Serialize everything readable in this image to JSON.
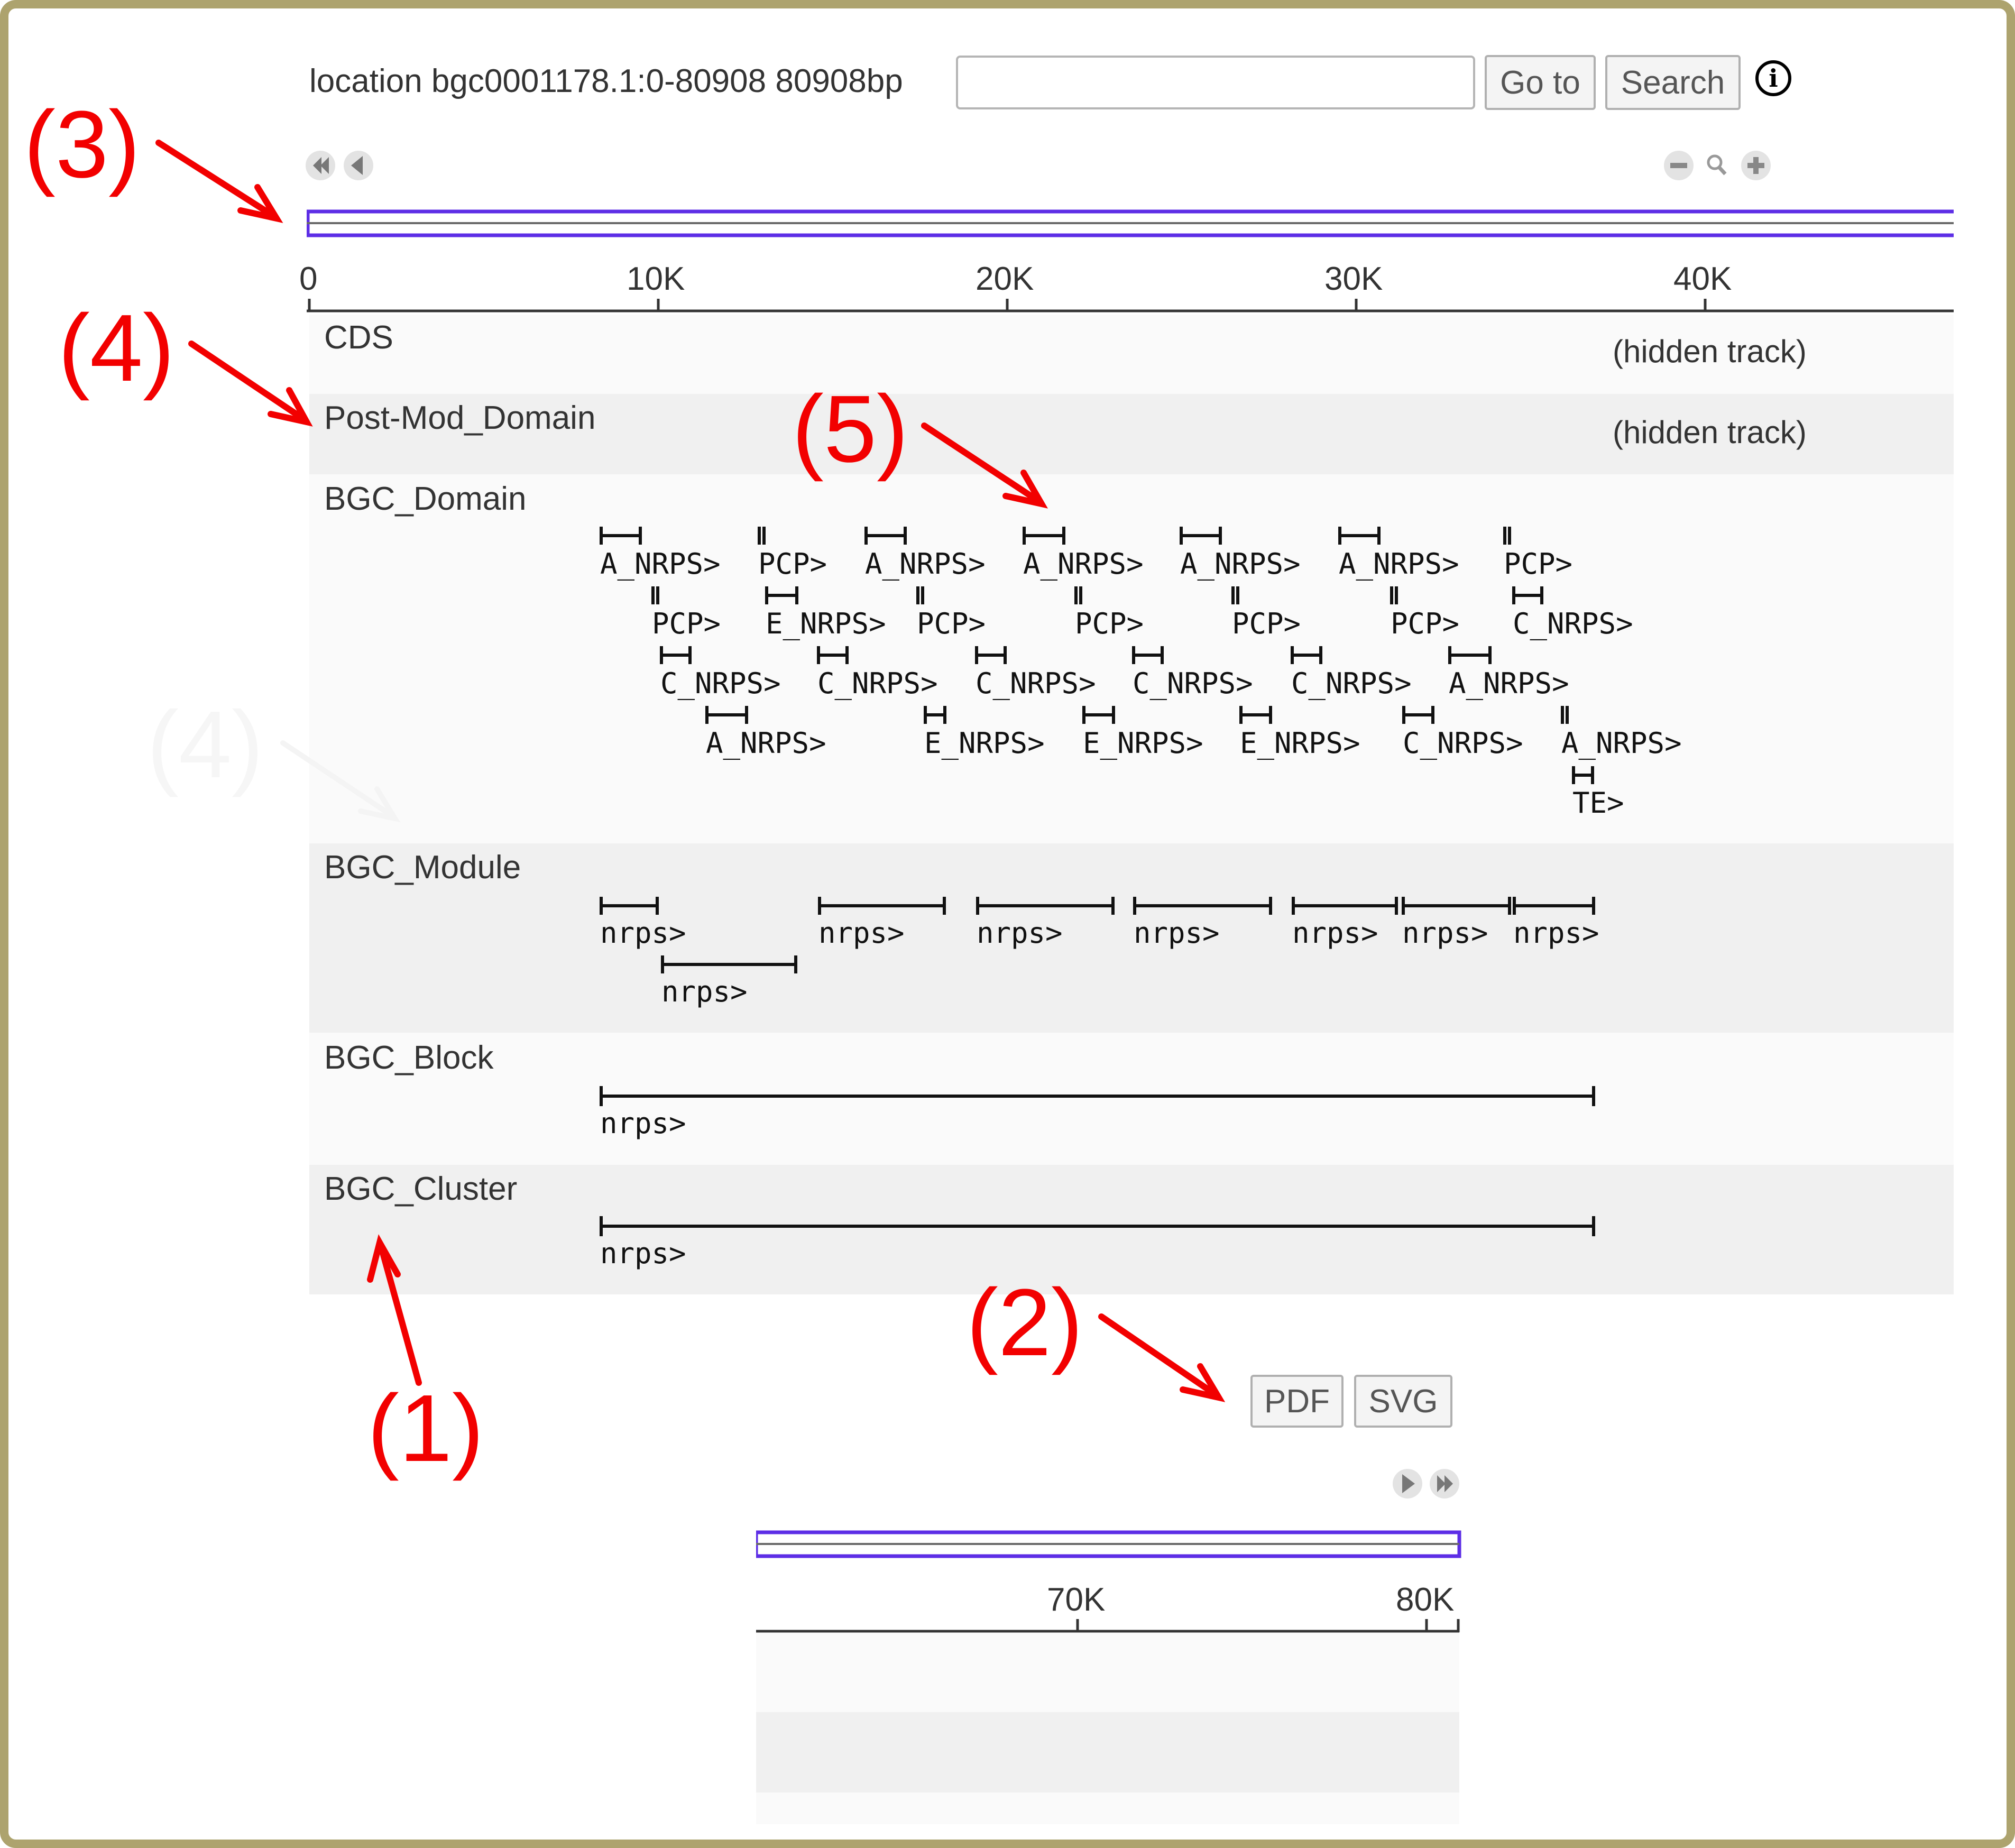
{
  "header": {
    "location_text": "location bgc0001178.1:0-80908 80908bp",
    "search_value": "",
    "goto_label": "Go to",
    "search_label": "Search",
    "info_glyph": "i"
  },
  "top_ruler": {
    "ticks": [
      "0",
      "10K",
      "20K",
      "30K",
      "40K"
    ]
  },
  "bottom_ruler": {
    "ticks": [
      "70K",
      "80K"
    ]
  },
  "tracks": [
    {
      "name": "CDS",
      "status": "(hidden track)"
    },
    {
      "name": "Post-Mod_Domain",
      "status": "(hidden track)"
    },
    {
      "name": "BGC_Domain"
    },
    {
      "name": "BGC_Module"
    },
    {
      "name": "BGC_Block"
    },
    {
      "name": "BGC_Cluster"
    }
  ],
  "domain_rows": [
    [
      "A_NRPS>",
      "PCP>",
      "A_NRPS>",
      "A_NRPS>",
      "A_NRPS>",
      "A_NRPS>",
      "PCP>"
    ],
    [
      "PCP>",
      "E_NRPS>",
      "PCP>",
      "PCP>",
      "PCP>",
      "PCP>",
      "C_NRPS>"
    ],
    [
      "C_NRPS>",
      "C_NRPS>",
      "C_NRPS>",
      "C_NRPS>",
      "C_NRPS>",
      "A_NRPS>"
    ],
    [
      "A_NRPS>",
      "E_NRPS>",
      "E_NRPS>",
      "E_NRPS>",
      "C_NRPS>",
      "A_NRPS>"
    ],
    [
      "TE>"
    ]
  ],
  "module_labels": [
    "nrps>",
    "nrps>",
    "nrps>",
    "nrps>",
    "nrps>",
    "nrps>",
    "nrps>",
    "nrps>"
  ],
  "block_label": "nrps>",
  "cluster_label": "nrps>",
  "export": {
    "pdf_label": "PDF",
    "svg_label": "SVG"
  },
  "annotations": [
    "(1)",
    "(2)",
    "(3)",
    "(4)",
    "(4)",
    "(5)"
  ],
  "icons": [
    "rewind-icon",
    "step-back-icon",
    "zoom-out-icon",
    "magnifier-icon",
    "zoom-in-icon",
    "step-forward-icon",
    "fast-forward-icon"
  ],
  "colors": {
    "frame": "#ada36e",
    "annotation": "#f20000",
    "overview_box": "#5d2ee6",
    "track_shaded": "#f0f0f0",
    "track_light": "#fafafa"
  }
}
